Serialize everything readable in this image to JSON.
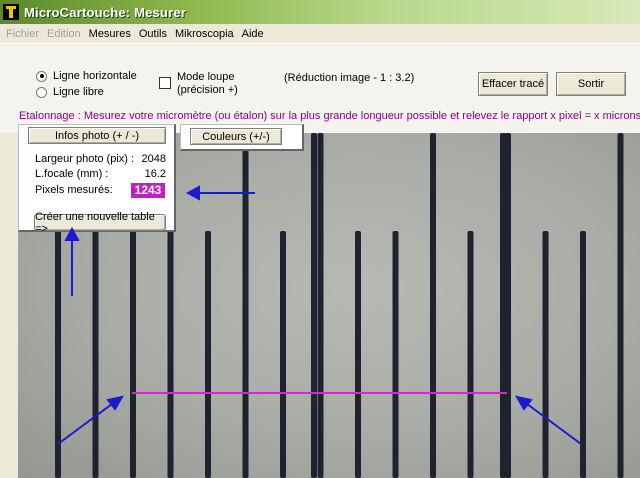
{
  "window": {
    "title": "MicroCartouche: Mesurer"
  },
  "menu": {
    "items": [
      "Fichier",
      "Edition",
      "Mesures",
      "Outils",
      "Mikroscopia",
      "Aide"
    ]
  },
  "options": {
    "radio_horizontal": "Ligne horizontale",
    "radio_libre": "Ligne libre",
    "mode_loupe_line1": "Mode loupe",
    "mode_loupe_line2": "(précision +)",
    "reduction": "(Réduction image - 1 : 3.2)",
    "clear_button": "Effacer tracé",
    "exit_button": "Sortir"
  },
  "calibration_text": "Etalonnage : Mesurez votre micromètre (ou étalon) sur la plus grande longueur possible et relevez le rapport x pixel = x microns.",
  "info": {
    "button": "Infos photo (+ / -)",
    "width_label": "Largeur photo (pix) :",
    "width_value": "2048",
    "focal_label": "L.focale (mm) :",
    "focal_value": "16.2",
    "pixels_label": "Pixels mesurés:",
    "pixels_value": "1243",
    "new_table_button": "Créer une nouvelle table =>"
  },
  "colors_button": "Couleurs (+/-)",
  "colors": {
    "measure_line": "#e020e0",
    "arrows": "#1a1ad0",
    "pixel_badge": "#c020c0",
    "calibration_text": "#8b008b"
  },
  "icons": [
    "app-icon",
    "blue-arrow-icon"
  ]
}
